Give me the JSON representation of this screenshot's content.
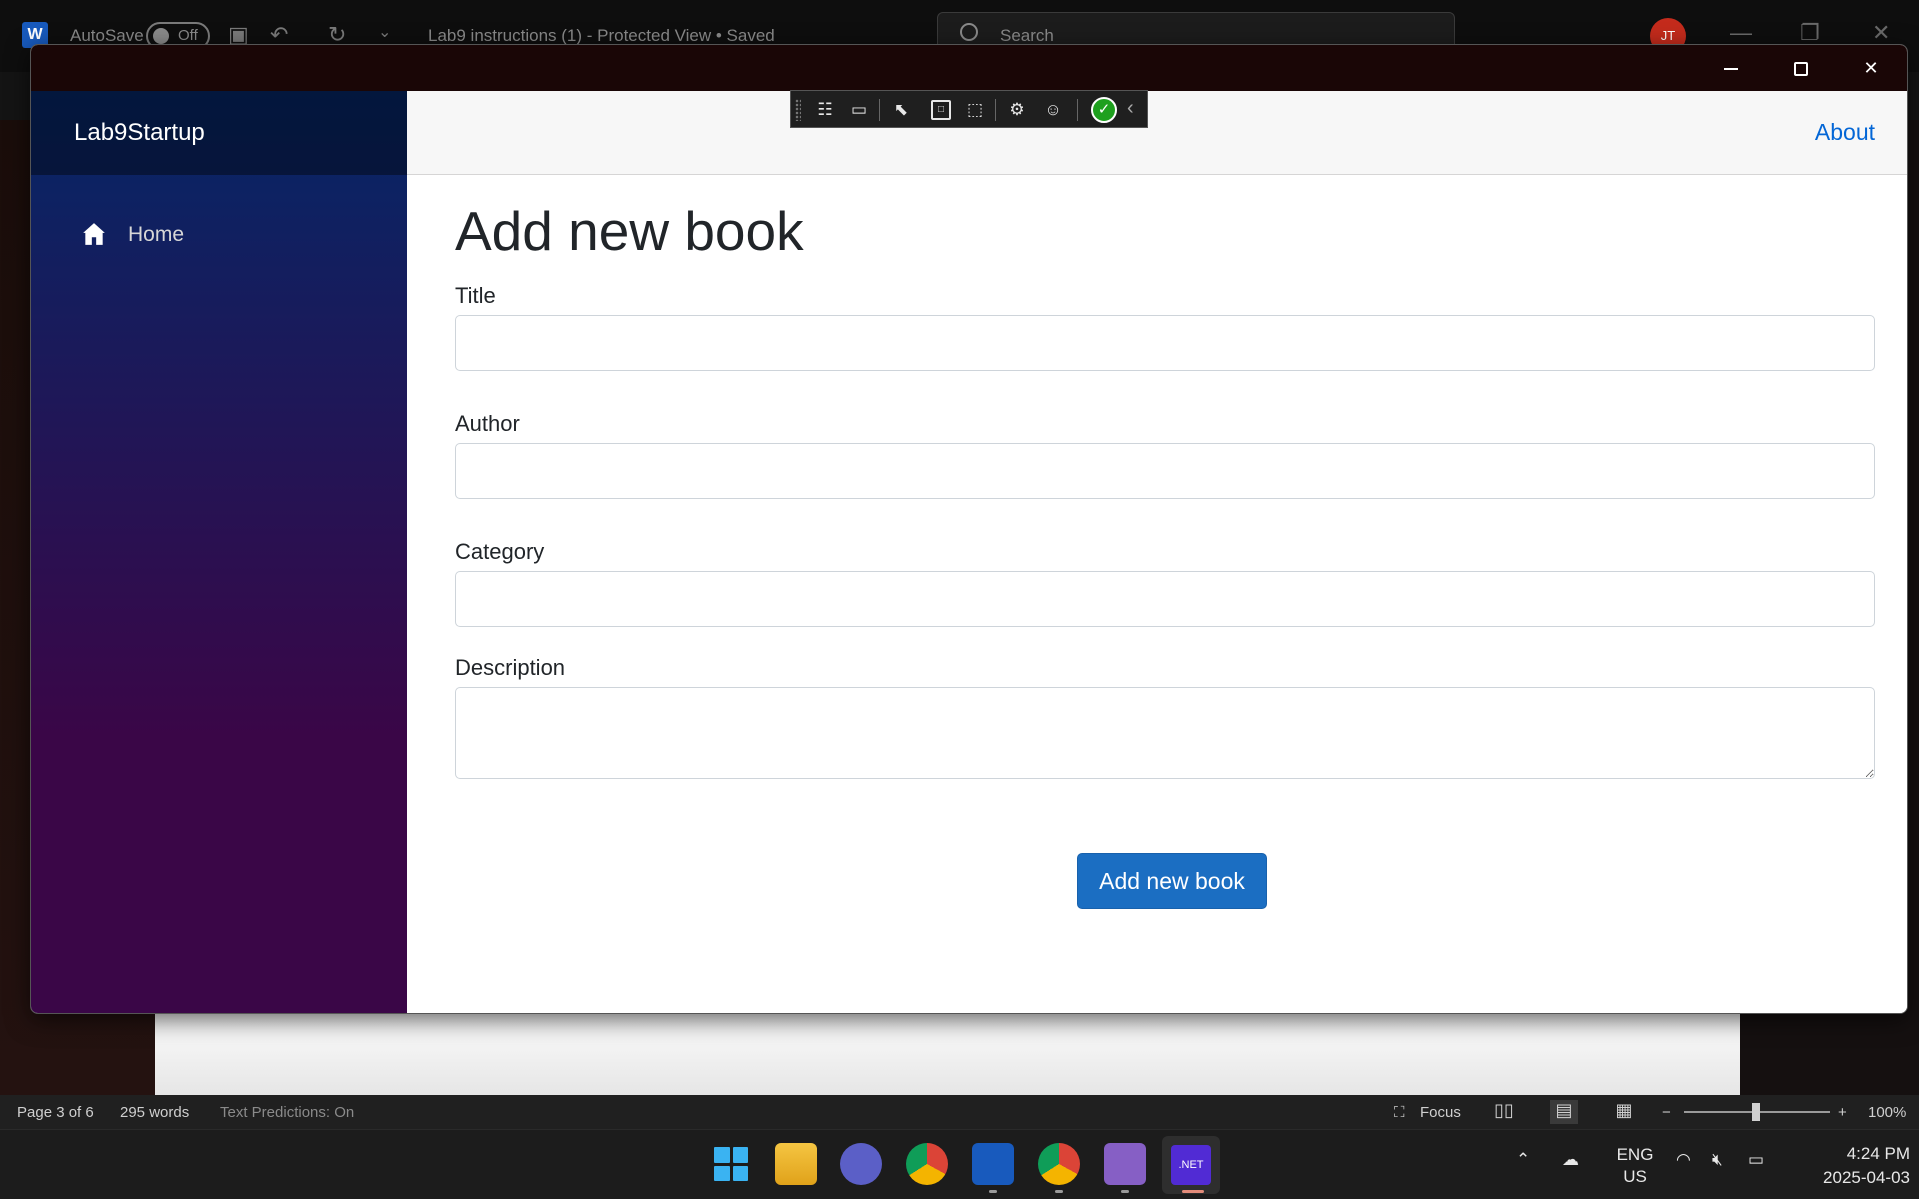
{
  "word": {
    "autosave_label": "AutoSave",
    "autosave_state": "Off",
    "doc_title": "Lab9 instructions (1)  -  Protected View • Saved",
    "search_placeholder": "Search",
    "user_initials": "JT"
  },
  "app": {
    "brand": "Lab9Startup",
    "nav": [
      {
        "label": "Home",
        "icon": "home-icon"
      }
    ],
    "top_link": "About",
    "page_title": "Add new book",
    "fields": {
      "title": {
        "label": "Title",
        "value": ""
      },
      "author": {
        "label": "Author",
        "value": ""
      },
      "category": {
        "label": "Category",
        "value": ""
      },
      "description": {
        "label": "Description",
        "value": ""
      }
    },
    "submit_label": "Add new book",
    "colors": {
      "primary": "#1b6ec2",
      "link": "#0366d6",
      "sidebar_top": "#052767",
      "sidebar_bottom": "#3a0647"
    }
  },
  "statusbar": {
    "page": "Page 3 of 6",
    "words": "295 words",
    "predictions": "Text Predictions: On",
    "focus": "Focus",
    "zoom": "100%"
  },
  "taskbar": {
    "language": "ENG",
    "region": "US",
    "time": "4:24 PM",
    "date": "2025-04-03",
    "dotnet_label": ".NET"
  }
}
